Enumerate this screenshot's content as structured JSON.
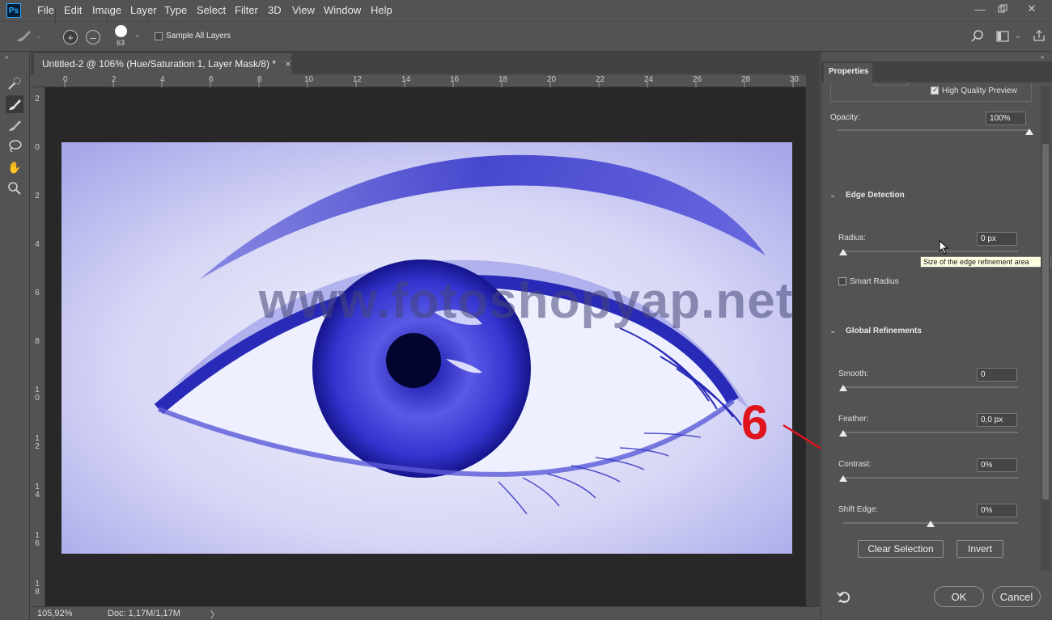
{
  "app": {
    "logo": "Ps"
  },
  "menu": [
    "File",
    "Edit",
    "Image",
    "Layer",
    "Type",
    "Select",
    "Filter",
    "3D",
    "View",
    "Window",
    "Help"
  ],
  "options_bar": {
    "brush_size": "63",
    "sample_all_layers_label": "Sample All Layers",
    "sample_all_layers_checked": false
  },
  "document": {
    "tab_title": "Untitled-2 @ 106% (Hue/Saturation 1, Layer Mask/8) *",
    "close_glyph": "×",
    "ruler_top": [
      "0",
      "2",
      "4",
      "6",
      "8",
      "10",
      "12",
      "14",
      "16",
      "18",
      "20",
      "22",
      "24",
      "26",
      "28",
      "30"
    ],
    "ruler_left": [
      "2",
      "0",
      "2",
      "4",
      "6",
      "8",
      "10",
      "12",
      "14",
      "16",
      "18"
    ],
    "watermark": "www.fotoshopyap.net",
    "zoom": "105,92%",
    "doc_info": "Doc: 1,17M/1,17M",
    "status_arrow": "〉"
  },
  "annotation": {
    "step": "6",
    "color": "#e0141c"
  },
  "properties": {
    "tab": "Properties",
    "high_quality_preview_label": "High Quality Preview",
    "high_quality_preview_checked": true,
    "opacity_label": "Opacity:",
    "opacity_value": "100%",
    "opacity_fraction": 1.0,
    "edge_detection": {
      "title": "Edge Detection",
      "radius_label": "Radius:",
      "radius_value": "0 px",
      "radius_fraction": 0.0,
      "tooltip": "Size of the edge refinement area",
      "smart_radius_label": "Smart Radius",
      "smart_radius_checked": false
    },
    "global_refinements": {
      "title": "Global Refinements",
      "smooth_label": "Smooth:",
      "smooth_value": "0",
      "feather_label": "Feather:",
      "feather_value": "0,0 px",
      "contrast_label": "Contrast:",
      "contrast_value": "0%",
      "shift_edge_label": "Shift Edge:",
      "shift_edge_value": "0%",
      "shift_edge_fraction": 0.5
    },
    "clear_selection_label": "Clear Selection",
    "invert_label": "Invert",
    "ok_label": "OK",
    "cancel_label": "Cancel"
  },
  "colors": {
    "panel": "#535353",
    "canvas_bg": "#282828",
    "image_tint": "#3535d8",
    "accent_red": "#e0141c"
  }
}
